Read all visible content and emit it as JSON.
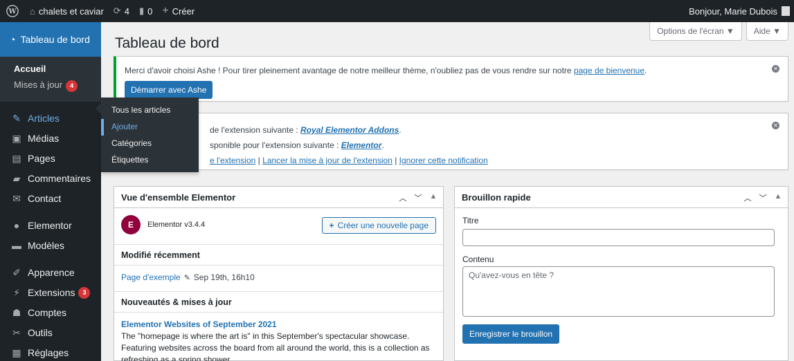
{
  "adminbar": {
    "site_name": "chalets et caviar",
    "updates_count": "4",
    "comments_count": "0",
    "new_label": "Créer",
    "greeting": "Bonjour, Marie Dubois"
  },
  "sidebar": {
    "dashboard_label": "Tableau de bord",
    "home_label": "Accueil",
    "updates_label": "Mises à jour",
    "updates_badge": "4",
    "items": [
      {
        "label": "Articles",
        "icon": "pin-icon"
      },
      {
        "label": "Médias",
        "icon": "media-icon"
      },
      {
        "label": "Pages",
        "icon": "page-icon"
      },
      {
        "label": "Commentaires",
        "icon": "comment-icon"
      },
      {
        "label": "Contact",
        "icon": "mail-icon"
      },
      {
        "label": "Elementor",
        "icon": "elementor-icon"
      },
      {
        "label": "Modèles",
        "icon": "folder-icon"
      },
      {
        "label": "Apparence",
        "icon": "brush-icon"
      },
      {
        "label": "Extensions",
        "icon": "plugin-icon",
        "badge": "3"
      },
      {
        "label": "Comptes",
        "icon": "user-icon"
      },
      {
        "label": "Outils",
        "icon": "wrench-icon"
      },
      {
        "label": "Réglages",
        "icon": "settings-icon"
      }
    ]
  },
  "flyout": {
    "items": [
      "Tous les articles",
      "Ajouter",
      "Catégories",
      "Étiquettes"
    ]
  },
  "screen_meta": {
    "options_label": "Options de l'écran ▼",
    "help_label": "Aide ▼"
  },
  "page_title": "Tableau de bord",
  "notice1": {
    "text_before": "Merci d'avoir choisi Ashe ! Pour tirer pleinement avantage de notre meilleur thème, n'oubliez pas de vous rendre sur notre ",
    "link": "page de bienvenue",
    "text_after": ".",
    "button": "Démarrer avec Ashe"
  },
  "notice2": {
    "line1_text": "de l'extension suivante : ",
    "line1_link": "Royal Elementor Addons",
    "line1_end": ".",
    "line2_text": "sponible pour l'extension suivante : ",
    "line2_link": "Elementor",
    "line2_end": ".",
    "line3_link1": "e l'extension",
    "line3_link2": "Lancer la mise à jour de l'extension",
    "line3_link3": "Ignorer cette notification"
  },
  "elementor_box": {
    "title": "Vue d'ensemble Elementor",
    "version": "Elementor v3.4.4",
    "create_button": "Créer une nouvelle page",
    "recent_title": "Modifié récemment",
    "recent_link": "Page d'exemple",
    "recent_date": "Sep 19th, 16h10",
    "news_title": "Nouveautés & mises à jour",
    "news_link": "Elementor Websites of September 2021",
    "news_excerpt": "The \"homepage is where the art is\" in this September's spectacular showcase. Featuring websites across the board from all around the world, this is a collection as refreshing as a spring shower."
  },
  "quickdraft": {
    "title": "Brouillon rapide",
    "title_label": "Titre",
    "title_value": "",
    "content_label": "Contenu",
    "content_placeholder": "Qu'avez-vous en tête ?",
    "save_button": "Enregistrer le brouillon"
  }
}
